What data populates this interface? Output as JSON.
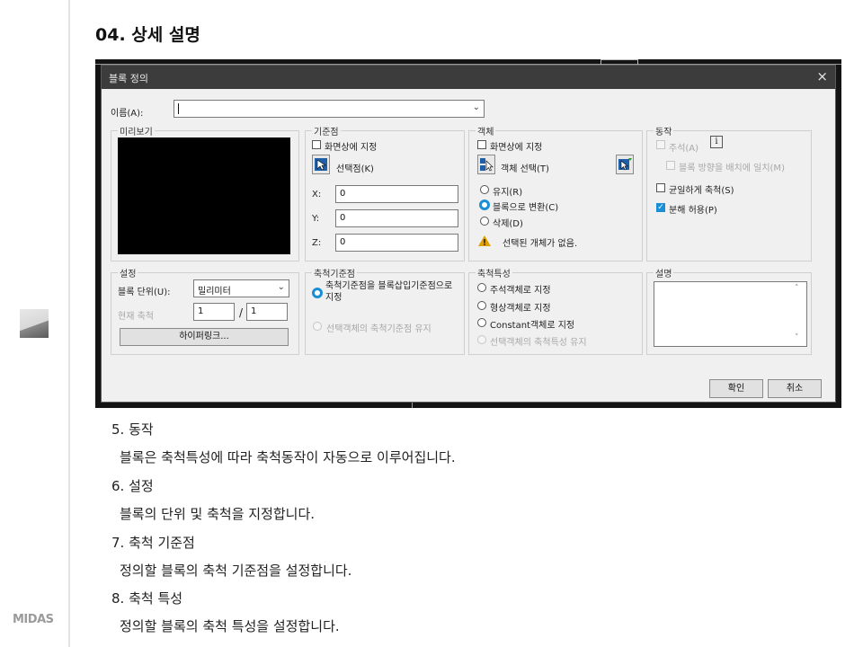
{
  "section": {
    "title": "04. 상세 설명"
  },
  "brand": {
    "logo_text": "MIDAS"
  },
  "dialog": {
    "title": "블록 정의",
    "close_glyph": "×",
    "name_label": "이름(A):",
    "name_value": "",
    "preview_group": "미리보기",
    "base_point": {
      "group": "기준점",
      "specify_on_screen": "화면상에 지정",
      "pick_point": "선택점(K)",
      "x_label": "X:",
      "x_value": "0",
      "y_label": "Y:",
      "y_value": "0",
      "z_label": "Z:",
      "z_value": "0"
    },
    "objects": {
      "group": "객체",
      "specify_on_screen": "화면상에 지정",
      "select_objects": "객체 선택(T)",
      "retain": "유지(R)",
      "convert_to_block": "블록으로 변환(C)",
      "delete": "삭제(D)",
      "warning": "선택된 개체가 없음."
    },
    "behavior": {
      "group": "동작",
      "annotative": "주석(A)",
      "match_orientation": "블록 방향을 배치에 일치(M)",
      "scale_uniformly": "균일하게 축척(S)",
      "allow_exploding": "분해 허용(P)"
    },
    "settings": {
      "group": "설정",
      "block_unit_label": "블록 단위(U):",
      "block_unit_value": "밀리미터",
      "current_scale_label": "현재 축척",
      "scale_a": "1",
      "scale_sep": "/",
      "scale_b": "1",
      "hyperlink_button": "하이퍼링크..."
    },
    "scale_base": {
      "group": "축척기준점",
      "option1": "축척기준점을 블록삽입기준점으로 지정",
      "option2": "선택객체의 축척기준점 유지"
    },
    "scale_props": {
      "group": "축척특성",
      "option1": "주석객체로 지정",
      "option2": "형상객체로 지정",
      "option3": "Constant객체로 지정",
      "option4": "선택객체의 축척특성 유지"
    },
    "description": {
      "group": "설명",
      "value": ""
    },
    "ok_button": "확인",
    "cancel_button": "취소"
  },
  "items": [
    {
      "head": "5. 동작",
      "desc": "블록은 축척특성에 따라 축척동작이 자동으로 이루어집니다."
    },
    {
      "head": "6. 설정",
      "desc": "블록의 단위 및 축척을 지정합니다."
    },
    {
      "head": "7. 축척 기준점",
      "desc": "정의할 블록의 축척 기준점을 설정합니다."
    },
    {
      "head": "8. 축척 특성",
      "desc": "정의할 블록의 축척 특성을 설정합니다."
    }
  ],
  "colors": {
    "accent": "#1a8fd6",
    "warning": "#e0a100",
    "titlebar": "#3c3c3c",
    "cad_background": "#141414"
  },
  "icons": [
    "pick-point-icon",
    "select-objects-icon",
    "quick-select-icon",
    "warning-icon",
    "info-icon",
    "dropdown-chevron-icon"
  ]
}
